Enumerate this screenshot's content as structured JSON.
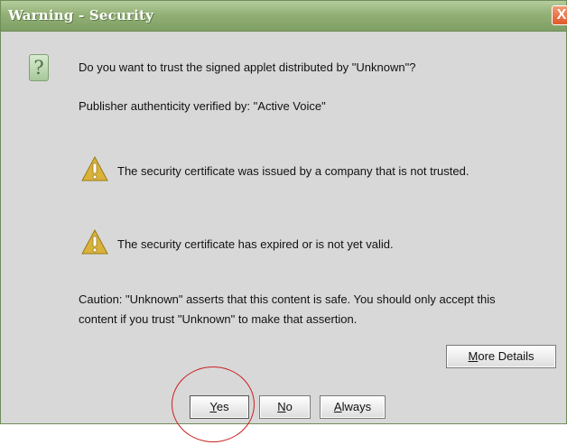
{
  "window": {
    "title": "Warning - Security",
    "close_glyph": "X"
  },
  "dialog": {
    "question": "Do you want to trust the signed applet distributed by \"Unknown\"?",
    "publisher": "Publisher authenticity verified by: \"Active Voice\"",
    "warnings": [
      "The security certificate was issued by a company that is not trusted.",
      "The security certificate has expired or is not yet valid."
    ],
    "caution_line1": "Caution: \"Unknown\" asserts that this content is safe. You should only accept this",
    "caution_line2": "content if you trust \"Unknown\" to make that assertion.",
    "question_icon_glyph": "?"
  },
  "buttons": {
    "more_details_mnemonic": "M",
    "more_details_rest": "ore Details",
    "yes_mnemonic": "Y",
    "yes_rest": "es",
    "no_mnemonic": "N",
    "no_rest": "o",
    "always_mnemonic": "A",
    "always_rest": "lways"
  },
  "colors": {
    "titlebar": "#93b177",
    "close_button": "#e0592b",
    "highlight": "#cc2020",
    "warning_fill": "#d9b23a"
  }
}
